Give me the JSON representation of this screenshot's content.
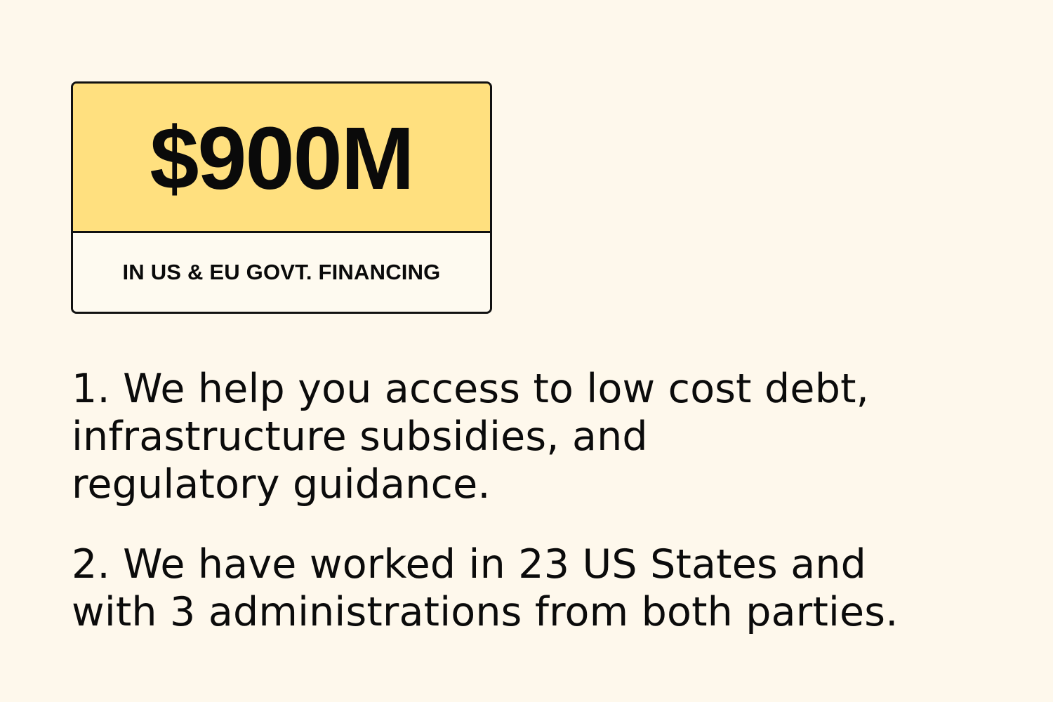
{
  "stat": {
    "value": "$900M",
    "caption": "IN US & EU GOVT. FINANCING"
  },
  "points": [
    {
      "lines": [
        "1. We help you access to low cost debt,",
        "infrastructure subsidies, and",
        "regulatory guidance."
      ]
    },
    {
      "lines": [
        "2. We have worked in 23 US States and",
        "with 3 administrations from both parties."
      ]
    }
  ],
  "colors": {
    "background": "#fef8ec",
    "highlight": "#ffe07f",
    "ink": "#0b0b0b"
  }
}
